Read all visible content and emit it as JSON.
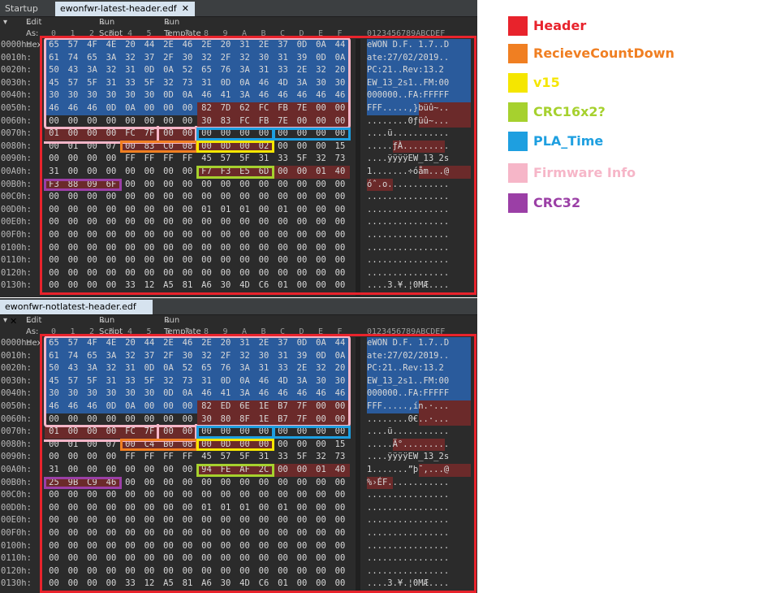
{
  "colors": {
    "header": "#e8232c",
    "recieve_countdown": "#f07f22",
    "v15": "#f5e600",
    "crc16": "#a6d12e",
    "pla_time": "#1e9fe0",
    "firmware_info": "#f6b6c8",
    "crc32": "#9b3fa6",
    "blue_bg": "#2a5b9c",
    "maroon_bg": "#6b2a2a"
  },
  "startup_tab": "Startup",
  "toolbar": {
    "icon": "collapse-arrows-icon",
    "edit_as": "Edit As: Hex",
    "run_script": "Run Script",
    "run_template": "Run Template",
    "dropdown_icon": "chevron-down-icon"
  },
  "col_headers": [
    "0",
    "1",
    "2",
    "3",
    "4",
    "5",
    "6",
    "7",
    "8",
    "9",
    "A",
    "B",
    "C",
    "D",
    "E",
    "F"
  ],
  "ascii_header": "0123456789ABCDEF",
  "panes": [
    {
      "tab": "ewonfwr-latest-header.edf",
      "rows": [
        {
          "addr": "0000h:",
          "hex": [
            "65",
            "57",
            "4F",
            "4E",
            "20",
            "44",
            "2E",
            "46",
            "2E",
            "20",
            "31",
            "2E",
            "37",
            "0D",
            "0A",
            "44"
          ],
          "ascii": "eWON D.F. 1.7..D"
        },
        {
          "addr": "0010h:",
          "hex": [
            "61",
            "74",
            "65",
            "3A",
            "32",
            "37",
            "2F",
            "30",
            "32",
            "2F",
            "32",
            "30",
            "31",
            "39",
            "0D",
            "0A"
          ],
          "ascii": "ate:27/02/2019.."
        },
        {
          "addr": "0020h:",
          "hex": [
            "50",
            "43",
            "3A",
            "32",
            "31",
            "0D",
            "0A",
            "52",
            "65",
            "76",
            "3A",
            "31",
            "33",
            "2E",
            "32",
            "20"
          ],
          "ascii": "PC:21..Rev:13.2 "
        },
        {
          "addr": "0030h:",
          "hex": [
            "45",
            "57",
            "5F",
            "31",
            "33",
            "5F",
            "32",
            "73",
            "31",
            "0D",
            "0A",
            "46",
            "4D",
            "3A",
            "30",
            "30"
          ],
          "ascii": "EW_13_2s1..FM:00"
        },
        {
          "addr": "0040h:",
          "hex": [
            "30",
            "30",
            "30",
            "30",
            "30",
            "30",
            "0D",
            "0A",
            "46",
            "41",
            "3A",
            "46",
            "46",
            "46",
            "46",
            "46"
          ],
          "ascii": "000000..FA:FFFFF"
        },
        {
          "addr": "0050h:",
          "hex": [
            "46",
            "46",
            "46",
            "0D",
            "0A",
            "00",
            "00",
            "00",
            "82",
            "7D",
            "62",
            "FC",
            "FB",
            "7E",
            "00",
            "00"
          ],
          "ascii": "FFF.....‚}büû~.."
        },
        {
          "addr": "0060h:",
          "hex": [
            "00",
            "00",
            "00",
            "00",
            "00",
            "00",
            "00",
            "00",
            "30",
            "83",
            "FC",
            "FB",
            "7E",
            "00",
            "00",
            "00"
          ],
          "ascii": "........0ƒüû~..."
        },
        {
          "addr": "0070h:",
          "hex": [
            "01",
            "00",
            "00",
            "00",
            "FC",
            "7F",
            "00",
            "00",
            "00",
            "00",
            "00",
            "00",
            "00",
            "00",
            "00",
            "00"
          ],
          "ascii": "....ü..........."
        },
        {
          "addr": "0080h:",
          "hex": [
            "00",
            "01",
            "00",
            "07",
            "00",
            "83",
            "C0",
            "08",
            "00",
            "0D",
            "00",
            "02",
            "00",
            "00",
            "00",
            "15"
          ],
          "ascii": ".....ƒÀ........."
        },
        {
          "addr": "0090h:",
          "hex": [
            "00",
            "00",
            "00",
            "00",
            "FF",
            "FF",
            "FF",
            "FF",
            "45",
            "57",
            "5F",
            "31",
            "33",
            "5F",
            "32",
            "73"
          ],
          "ascii": "....ÿÿÿÿEW_13_2s"
        },
        {
          "addr": "00A0h:",
          "hex": [
            "31",
            "00",
            "00",
            "00",
            "00",
            "00",
            "00",
            "00",
            "F7",
            "F3",
            "E5",
            "6D",
            "00",
            "00",
            "01",
            "40"
          ],
          "ascii": "1.......÷óåm...@"
        },
        {
          "addr": "00B0h:",
          "hex": [
            "F3",
            "88",
            "09",
            "6F",
            "00",
            "00",
            "00",
            "00",
            "00",
            "00",
            "00",
            "00",
            "00",
            "00",
            "00",
            "00"
          ],
          "ascii": "óˆ.o............"
        },
        {
          "addr": "00C0h:",
          "hex": [
            "00",
            "00",
            "00",
            "00",
            "00",
            "00",
            "00",
            "00",
            "00",
            "00",
            "00",
            "00",
            "00",
            "00",
            "00",
            "00"
          ],
          "ascii": "................"
        },
        {
          "addr": "00D0h:",
          "hex": [
            "00",
            "00",
            "00",
            "00",
            "00",
            "00",
            "00",
            "00",
            "01",
            "01",
            "01",
            "00",
            "01",
            "00",
            "00",
            "00"
          ],
          "ascii": "................"
        },
        {
          "addr": "00E0h:",
          "hex": [
            "00",
            "00",
            "00",
            "00",
            "00",
            "00",
            "00",
            "00",
            "00",
            "00",
            "00",
            "00",
            "00",
            "00",
            "00",
            "00"
          ],
          "ascii": "................"
        },
        {
          "addr": "00F0h:",
          "hex": [
            "00",
            "00",
            "00",
            "00",
            "00",
            "00",
            "00",
            "00",
            "00",
            "00",
            "00",
            "00",
            "00",
            "00",
            "00",
            "00"
          ],
          "ascii": "................"
        },
        {
          "addr": "0100h:",
          "hex": [
            "00",
            "00",
            "00",
            "00",
            "00",
            "00",
            "00",
            "00",
            "00",
            "00",
            "00",
            "00",
            "00",
            "00",
            "00",
            "00"
          ],
          "ascii": "................"
        },
        {
          "addr": "0110h:",
          "hex": [
            "00",
            "00",
            "00",
            "00",
            "00",
            "00",
            "00",
            "00",
            "00",
            "00",
            "00",
            "00",
            "00",
            "00",
            "00",
            "00"
          ],
          "ascii": "................"
        },
        {
          "addr": "0120h:",
          "hex": [
            "00",
            "00",
            "00",
            "00",
            "00",
            "00",
            "00",
            "00",
            "00",
            "00",
            "00",
            "00",
            "00",
            "00",
            "00",
            "00"
          ],
          "ascii": "................"
        },
        {
          "addr": "0130h:",
          "hex": [
            "00",
            "00",
            "00",
            "00",
            "33",
            "12",
            "A5",
            "81",
            "A6",
            "30",
            "4D",
            "C6",
            "01",
            "00",
            "00",
            "00"
          ],
          "ascii": "....3.¥.¦0MÆ...."
        }
      ]
    },
    {
      "tab": "ewonfwr-notlatest-header.edf",
      "rows": [
        {
          "addr": "0000h:",
          "hex": [
            "65",
            "57",
            "4F",
            "4E",
            "20",
            "44",
            "2E",
            "46",
            "2E",
            "20",
            "31",
            "2E",
            "37",
            "0D",
            "0A",
            "44"
          ],
          "ascii": "eWON D.F. 1.7..D"
        },
        {
          "addr": "0010h:",
          "hex": [
            "61",
            "74",
            "65",
            "3A",
            "32",
            "37",
            "2F",
            "30",
            "32",
            "2F",
            "32",
            "30",
            "31",
            "39",
            "0D",
            "0A"
          ],
          "ascii": "ate:27/02/2019.."
        },
        {
          "addr": "0020h:",
          "hex": [
            "50",
            "43",
            "3A",
            "32",
            "31",
            "0D",
            "0A",
            "52",
            "65",
            "76",
            "3A",
            "31",
            "33",
            "2E",
            "32",
            "20"
          ],
          "ascii": "PC:21..Rev:13.2 "
        },
        {
          "addr": "0030h:",
          "hex": [
            "45",
            "57",
            "5F",
            "31",
            "33",
            "5F",
            "32",
            "73",
            "31",
            "0D",
            "0A",
            "46",
            "4D",
            "3A",
            "30",
            "30"
          ],
          "ascii": "EW_13_2s1..FM:00"
        },
        {
          "addr": "0040h:",
          "hex": [
            "30",
            "30",
            "30",
            "30",
            "30",
            "30",
            "0D",
            "0A",
            "46",
            "41",
            "3A",
            "46",
            "46",
            "46",
            "46",
            "46"
          ],
          "ascii": "000000..FA:FFFFF"
        },
        {
          "addr": "0050h:",
          "hex": [
            "46",
            "46",
            "46",
            "0D",
            "0A",
            "00",
            "00",
            "00",
            "82",
            "ED",
            "6E",
            "1E",
            "B7",
            "7F",
            "00",
            "00"
          ],
          "ascii": "FFF.....‚ín.·..."
        },
        {
          "addr": "0060h:",
          "hex": [
            "00",
            "00",
            "00",
            "00",
            "00",
            "00",
            "00",
            "00",
            "30",
            "80",
            "8F",
            "1E",
            "B7",
            "7F",
            "00",
            "00"
          ],
          "ascii": "........0€..·..."
        },
        {
          "addr": "0070h:",
          "hex": [
            "01",
            "00",
            "00",
            "00",
            "FC",
            "7F",
            "00",
            "00",
            "00",
            "00",
            "00",
            "00",
            "00",
            "00",
            "00",
            "00"
          ],
          "ascii": "....ü..........."
        },
        {
          "addr": "0080h:",
          "hex": [
            "00",
            "01",
            "00",
            "07",
            "00",
            "C4",
            "B0",
            "08",
            "00",
            "0D",
            "00",
            "00",
            "00",
            "00",
            "00",
            "15"
          ],
          "ascii": ".....Ä°........."
        },
        {
          "addr": "0090h:",
          "hex": [
            "00",
            "00",
            "00",
            "00",
            "FF",
            "FF",
            "FF",
            "FF",
            "45",
            "57",
            "5F",
            "31",
            "33",
            "5F",
            "32",
            "73"
          ],
          "ascii": "....ÿÿÿÿEW_13_2s"
        },
        {
          "addr": "00A0h:",
          "hex": [
            "31",
            "00",
            "00",
            "00",
            "00",
            "00",
            "00",
            "00",
            "94",
            "FE",
            "AF",
            "2C",
            "00",
            "00",
            "01",
            "40"
          ],
          "ascii": "1.......”þ¯,...@"
        },
        {
          "addr": "00B0h:",
          "hex": [
            "25",
            "9B",
            "C9",
            "46",
            "00",
            "00",
            "00",
            "00",
            "00",
            "00",
            "00",
            "00",
            "00",
            "00",
            "00",
            "00"
          ],
          "ascii": "%›ÉF............"
        },
        {
          "addr": "00C0h:",
          "hex": [
            "00",
            "00",
            "00",
            "00",
            "00",
            "00",
            "00",
            "00",
            "00",
            "00",
            "00",
            "00",
            "00",
            "00",
            "00",
            "00"
          ],
          "ascii": "................"
        },
        {
          "addr": "00D0h:",
          "hex": [
            "00",
            "00",
            "00",
            "00",
            "00",
            "00",
            "00",
            "00",
            "01",
            "01",
            "01",
            "00",
            "01",
            "00",
            "00",
            "00"
          ],
          "ascii": "................"
        },
        {
          "addr": "00E0h:",
          "hex": [
            "00",
            "00",
            "00",
            "00",
            "00",
            "00",
            "00",
            "00",
            "00",
            "00",
            "00",
            "00",
            "00",
            "00",
            "00",
            "00"
          ],
          "ascii": "................"
        },
        {
          "addr": "00F0h:",
          "hex": [
            "00",
            "00",
            "00",
            "00",
            "00",
            "00",
            "00",
            "00",
            "00",
            "00",
            "00",
            "00",
            "00",
            "00",
            "00",
            "00"
          ],
          "ascii": "................"
        },
        {
          "addr": "0100h:",
          "hex": [
            "00",
            "00",
            "00",
            "00",
            "00",
            "00",
            "00",
            "00",
            "00",
            "00",
            "00",
            "00",
            "00",
            "00",
            "00",
            "00"
          ],
          "ascii": "................"
        },
        {
          "addr": "0110h:",
          "hex": [
            "00",
            "00",
            "00",
            "00",
            "00",
            "00",
            "00",
            "00",
            "00",
            "00",
            "00",
            "00",
            "00",
            "00",
            "00",
            "00"
          ],
          "ascii": "................"
        },
        {
          "addr": "0120h:",
          "hex": [
            "00",
            "00",
            "00",
            "00",
            "00",
            "00",
            "00",
            "00",
            "00",
            "00",
            "00",
            "00",
            "00",
            "00",
            "00",
            "00"
          ],
          "ascii": "................"
        },
        {
          "addr": "0130h:",
          "hex": [
            "00",
            "00",
            "00",
            "00",
            "33",
            "12",
            "A5",
            "81",
            "A6",
            "30",
            "4D",
            "C6",
            "01",
            "00",
            "00",
            "00"
          ],
          "ascii": "....3.¥.¦0MÆ...."
        }
      ]
    }
  ],
  "legend": [
    {
      "key": "header",
      "label": "Header"
    },
    {
      "key": "recieve_countdown",
      "label": "RecieveCountDown"
    },
    {
      "key": "v15",
      "label": "v15"
    },
    {
      "key": "crc16",
      "label": "CRC16x2?"
    },
    {
      "key": "pla_time",
      "label": "PLA_Time"
    },
    {
      "key": "firmware_info",
      "label": "Firmware Info"
    },
    {
      "key": "crc32",
      "label": "CRC32"
    }
  ]
}
